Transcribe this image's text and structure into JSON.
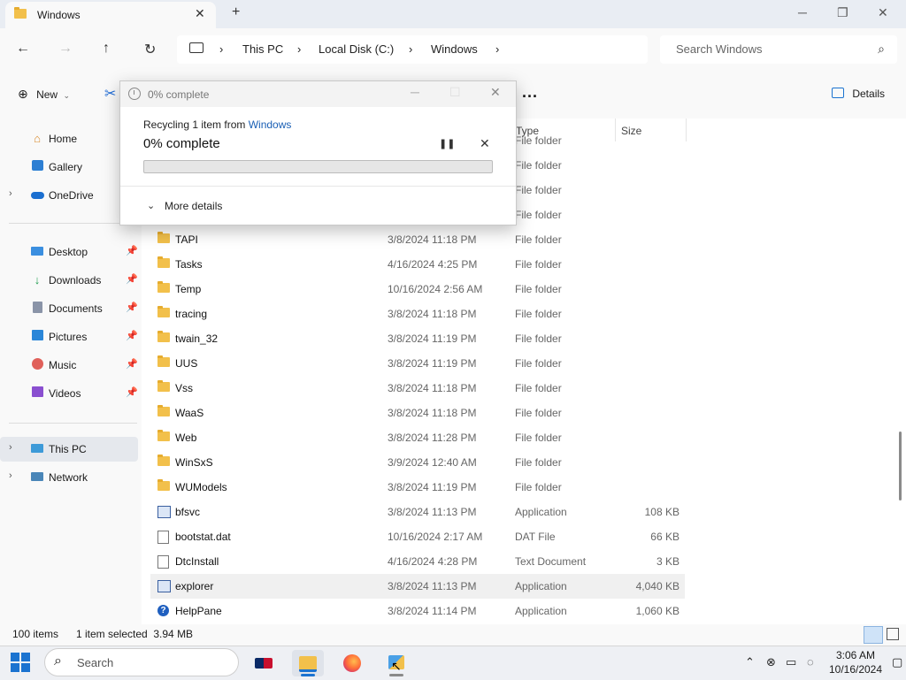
{
  "window": {
    "tab_title": "Windows",
    "new_tab": "+",
    "close_tab": "✕",
    "minimize": "─",
    "maximize": "❐",
    "close": "✕"
  },
  "nav": {
    "back": "←",
    "forward": "→",
    "up": "↑",
    "refresh": "↻",
    "breadcrumb": [
      "This PC",
      "Local Disk (C:)",
      "Windows"
    ],
    "search_placeholder": "Search Windows"
  },
  "command_bar": {
    "new_label": "New",
    "more": "...",
    "details_label": "Details"
  },
  "sidebar": {
    "top": [
      {
        "label": "Home",
        "icon": "home-icon"
      },
      {
        "label": "Gallery",
        "icon": "gallery-icon"
      },
      {
        "label": "OneDrive",
        "icon": "onedrive-icon"
      }
    ],
    "quick": [
      {
        "label": "Desktop",
        "icon": "desktop-icon"
      },
      {
        "label": "Downloads",
        "icon": "downloads-icon"
      },
      {
        "label": "Documents",
        "icon": "documents-icon"
      },
      {
        "label": "Pictures",
        "icon": "pictures-icon"
      },
      {
        "label": "Music",
        "icon": "music-icon"
      },
      {
        "label": "Videos",
        "icon": "videos-icon"
      }
    ],
    "devices": [
      {
        "label": "This PC",
        "icon": "this-pc-icon"
      },
      {
        "label": "Network",
        "icon": "network-icon"
      }
    ]
  },
  "columns": {
    "type": "Type",
    "size": "Size"
  },
  "files": [
    {
      "name": "",
      "date": "",
      "type": "File folder",
      "size": "",
      "kind": "folder"
    },
    {
      "name": "",
      "date": "",
      "type": "File folder",
      "size": "",
      "kind": "folder"
    },
    {
      "name": "",
      "date": "",
      "type": "File folder",
      "size": "",
      "kind": "folder"
    },
    {
      "name": "",
      "date": "",
      "type": "File folder",
      "size": "",
      "kind": "folder"
    },
    {
      "name": "TAPI",
      "date": "3/8/2024 11:18 PM",
      "type": "File folder",
      "size": "",
      "kind": "folder"
    },
    {
      "name": "Tasks",
      "date": "4/16/2024 4:25 PM",
      "type": "File folder",
      "size": "",
      "kind": "folder"
    },
    {
      "name": "Temp",
      "date": "10/16/2024 2:56 AM",
      "type": "File folder",
      "size": "",
      "kind": "folder"
    },
    {
      "name": "tracing",
      "date": "3/8/2024 11:18 PM",
      "type": "File folder",
      "size": "",
      "kind": "folder"
    },
    {
      "name": "twain_32",
      "date": "3/8/2024 11:19 PM",
      "type": "File folder",
      "size": "",
      "kind": "folder"
    },
    {
      "name": "UUS",
      "date": "3/8/2024 11:19 PM",
      "type": "File folder",
      "size": "",
      "kind": "folder"
    },
    {
      "name": "Vss",
      "date": "3/8/2024 11:18 PM",
      "type": "File folder",
      "size": "",
      "kind": "folder"
    },
    {
      "name": "WaaS",
      "date": "3/8/2024 11:18 PM",
      "type": "File folder",
      "size": "",
      "kind": "folder"
    },
    {
      "name": "Web",
      "date": "3/8/2024 11:28 PM",
      "type": "File folder",
      "size": "",
      "kind": "folder"
    },
    {
      "name": "WinSxS",
      "date": "3/9/2024 12:40 AM",
      "type": "File folder",
      "size": "",
      "kind": "folder"
    },
    {
      "name": "WUModels",
      "date": "3/8/2024 11:19 PM",
      "type": "File folder",
      "size": "",
      "kind": "folder"
    },
    {
      "name": "bfsvc",
      "date": "3/8/2024 11:13 PM",
      "type": "Application",
      "size": "108 KB",
      "kind": "app"
    },
    {
      "name": "bootstat.dat",
      "date": "10/16/2024 2:17 AM",
      "type": "DAT File",
      "size": "66 KB",
      "kind": "file"
    },
    {
      "name": "DtcInstall",
      "date": "4/16/2024 4:28 PM",
      "type": "Text Document",
      "size": "3 KB",
      "kind": "file"
    },
    {
      "name": "explorer",
      "date": "3/8/2024 11:13 PM",
      "type": "Application",
      "size": "4,040 KB",
      "kind": "app",
      "selected": true
    },
    {
      "name": "HelpPane",
      "date": "3/8/2024 11:14 PM",
      "type": "Application",
      "size": "1,060 KB",
      "kind": "help"
    }
  ],
  "status": {
    "item_count": "100 items",
    "selection": "1 item selected  3.94 MB"
  },
  "taskbar": {
    "search_placeholder": "Search",
    "time": "3:06 AM",
    "date": "10/16/2024"
  },
  "dialog": {
    "title": "0% complete",
    "recycling_prefix": "Recycling 1 item from ",
    "recycling_source": "Windows",
    "percent_text": "0% complete",
    "progress": 0,
    "more_details": "More details",
    "progress_color": "#06b025"
  }
}
